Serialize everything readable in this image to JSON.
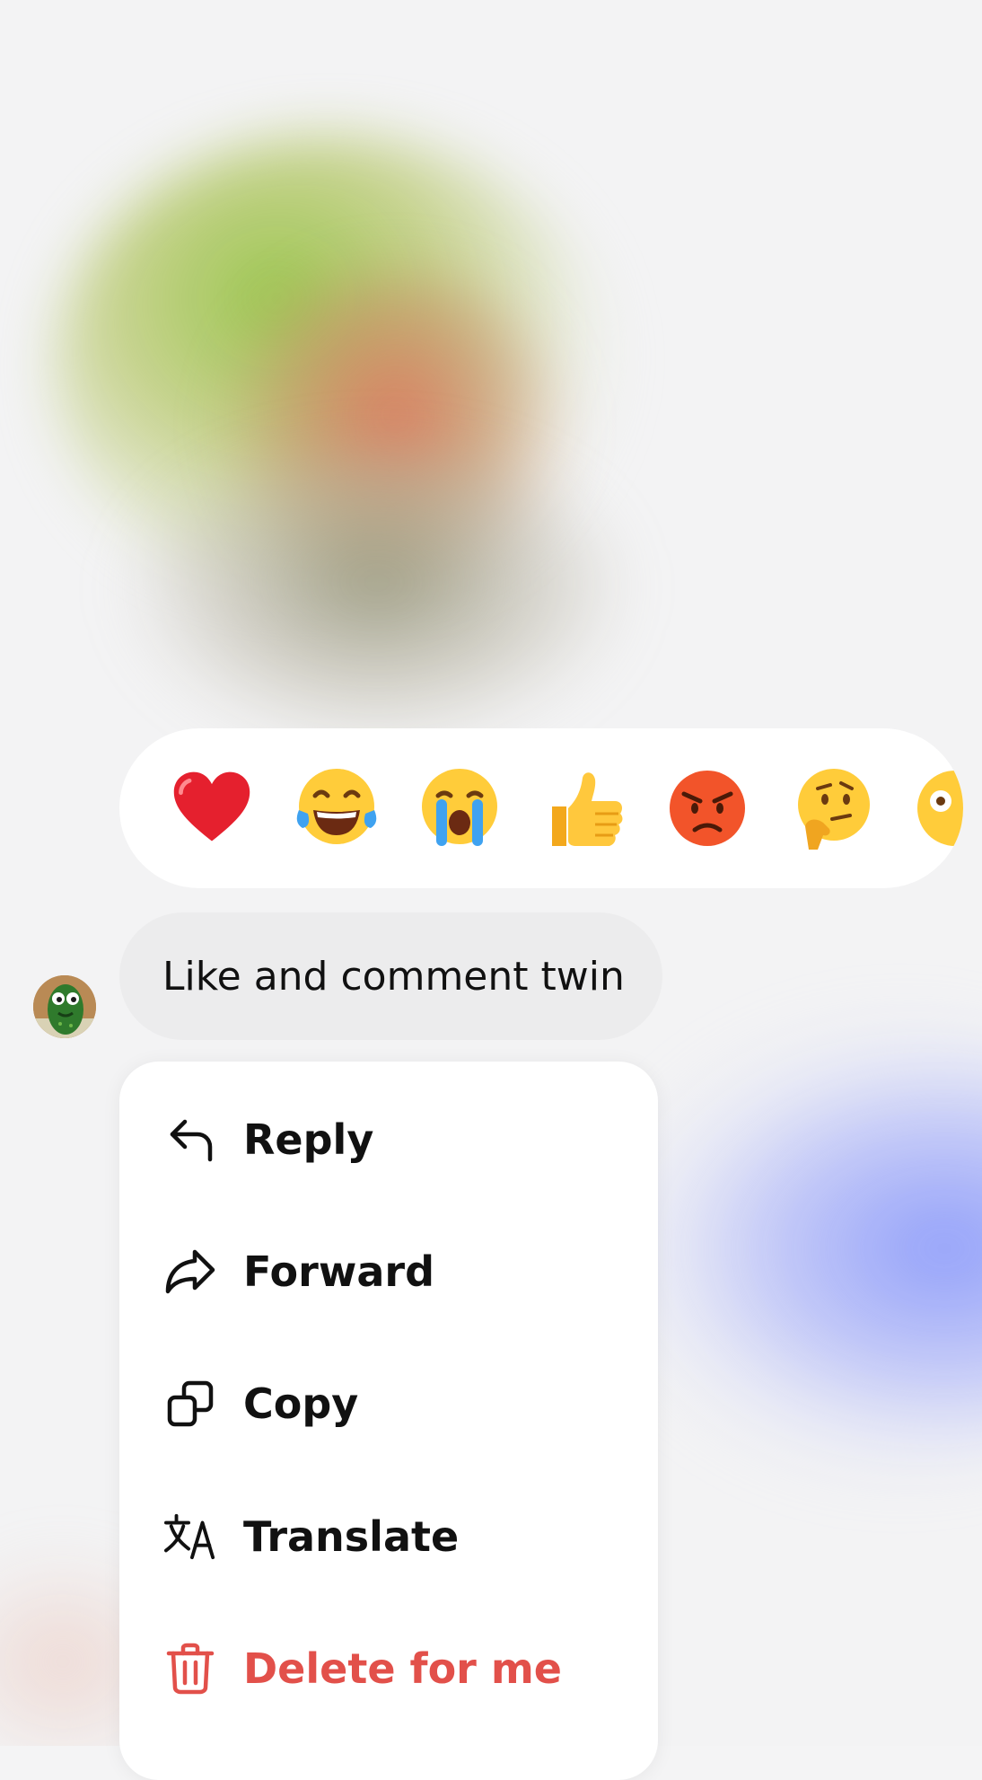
{
  "reactions": [
    {
      "icon": "red-heart-icon"
    },
    {
      "icon": "tears-of-joy-face-icon"
    },
    {
      "icon": "loudly-crying-face-icon"
    },
    {
      "icon": "thumbs-up-icon"
    },
    {
      "icon": "angry-face-icon"
    },
    {
      "icon": "thinking-face-icon"
    },
    {
      "icon": "flushed-face-icon"
    }
  ],
  "message": {
    "text": "Like and comment twin",
    "avatar_icon": "cucumber-avatar"
  },
  "menu": {
    "items": [
      {
        "label": "Reply",
        "icon": "reply-arrow-icon"
      },
      {
        "label": "Forward",
        "icon": "forward-arrow-icon"
      },
      {
        "label": "Copy",
        "icon": "copy-icon"
      },
      {
        "label": "Translate",
        "icon": "translate-icon"
      },
      {
        "label": "Delete for me",
        "icon": "trash-icon",
        "color": "#e2504a"
      }
    ]
  }
}
